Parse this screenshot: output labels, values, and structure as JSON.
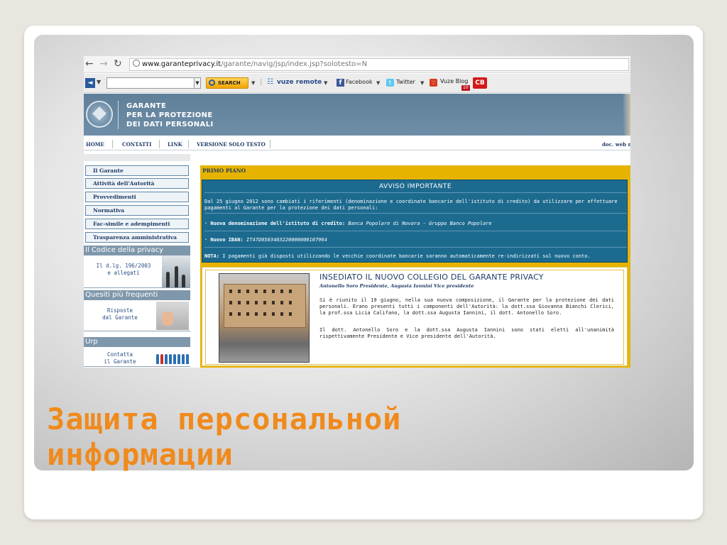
{
  "browser": {
    "url_domain": "www.garanteprivacy.it",
    "url_path": "/garante/navig/jsp/index.jsp?solotesto=N"
  },
  "toolbar": {
    "search_label": "SEARCH",
    "vuze_label": "vuze remote",
    "facebook_label": "Facebook",
    "twitter_label": "Twitter",
    "blog_label": "Vuze Blog",
    "blog_badge": "10",
    "cb_label": "CB"
  },
  "site_header": {
    "line1": "GARANTE",
    "line2": "PER LA PROTEZIONE",
    "line3": "DEI DATI PERSONALI"
  },
  "site_nav": {
    "home": "HOME",
    "contatti": "CONTATTI",
    "link": "LINK",
    "versione": "VERSIONE SOLO TESTO",
    "doc": "doc. web n"
  },
  "left_menu": {
    "items": [
      "Il Garante",
      "Attività dell'Autorità",
      "Provvedimenti",
      "Normativa",
      "Fac-simile e adempimenti",
      "Trasparenza amministrativa"
    ],
    "codice_title": "Il Codice della privacy",
    "codice_text_1": "Il d.lg. 196/2003",
    "codice_text_2": "e allegati",
    "quesiti_title": "Quesiti più frequenti",
    "quesiti_text_1": "Risposte",
    "quesiti_text_2": "dal Garante",
    "urp_title": "Urp",
    "urp_text_1": "Contatta",
    "urp_text_2": "il Garante"
  },
  "main": {
    "section_title": "PRIMO PIANO",
    "notice": {
      "title": "AVVISO IMPORTANTE",
      "intro": "Dal 25 giugno 2012 sono cambiati i riferimenti (denominazione e coordinate bancarie dell'istituto di credito) da utilizzare per effettuare pagamenti al Garante per la protezione dei dati personali:",
      "denominazione_label": "· Nuova denominazione dell'istituto di credito:",
      "denominazione_value": "Banca Popolare di Novara - Gruppo Banco Popolare",
      "iban_label": "· Nuovo IBAN:",
      "iban_value": "IT47D0503403220000000107964",
      "nota_label": "NOTA:",
      "nota_text": "I pagamenti già disposti utilizzando le vecchie coordinate bancarie saranno automaticamente re-indirizzati sul nuovo conto."
    },
    "news": {
      "title": "INSEDIATO IL NUOVO COLLEGIO DEL GARANTE PRIVACY",
      "subtitle": "Antonello Soro Presidente, Augusta Iannini Vice presidente",
      "paragraph1": "Si è riunito il 19 giugno, nella sua nuova composizione, il Garante per la protezione dei dati personali. Erano presenti tutti i componenti dell'Autorità: la dott.ssa Giovanna Bianchi Clerici, la prof.ssa Licia Califano, la dott.ssa Augusta Iannini, il dott. Antonello Soro.",
      "paragraph2": "Il dott. Antonello Soro e la dott.ssa Augusta Iannini sono stati eletti all'unanimità rispettivamente Presidente e Vice presidente dell'Autorità."
    }
  },
  "slide": {
    "caption_line1": "Защита персональной",
    "caption_line2": "информации"
  },
  "colors": {
    "caption": "#f08a1c",
    "header_bg": "#6f8ea8",
    "notice_bg": "#1d6a8f",
    "primo_piano_bg": "#e6b400"
  }
}
